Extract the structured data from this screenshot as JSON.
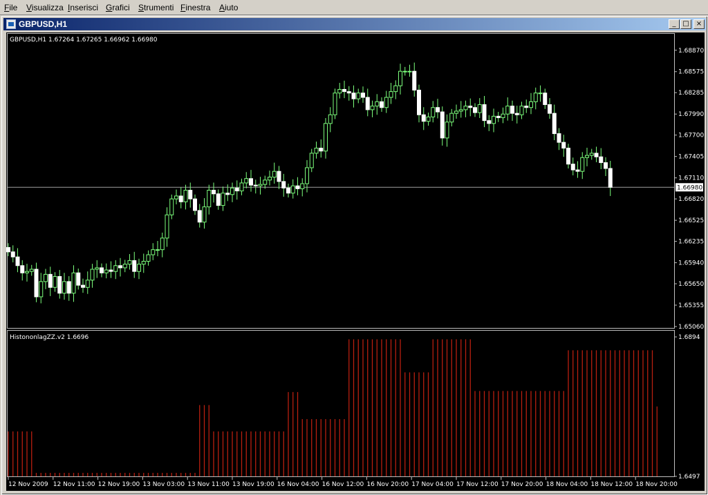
{
  "menu": [
    {
      "accel": "F",
      "rest": "ile"
    },
    {
      "accel": "V",
      "rest": "isualizza"
    },
    {
      "accel": "I",
      "rest": "nserisci"
    },
    {
      "accel": "G",
      "rest": "rafici"
    },
    {
      "accel": "S",
      "rest": "trumenti"
    },
    {
      "accel": "F",
      "rest": "inestra"
    },
    {
      "accel": "A",
      "rest": "iuto"
    }
  ],
  "window": {
    "title": "GBPUSD,H1",
    "minimize": "_",
    "maximize": "□",
    "close": "×"
  },
  "colors": {
    "bull": "#7cff7c",
    "bear": "#ffffff",
    "frame": "#c0c0c0",
    "histogram": "#b82010",
    "bid_line": "#a0a0a0"
  },
  "chart_data": [
    {
      "type": "candlestick",
      "symbol_label": "GBPUSD,H1",
      "ohlc_label": "1.67264 1.67265 1.66962 1.66980",
      "y_ticks": [
        "1.68870",
        "1.68575",
        "1.68285",
        "1.67990",
        "1.67700",
        "1.67405",
        "1.67110",
        "1.66820",
        "1.66525",
        "1.66235",
        "1.65940",
        "1.65650",
        "1.65355",
        "1.65060"
      ],
      "ylim": [
        1.6506,
        1.6902
      ],
      "current_price": "1.66980",
      "x_ticks": [
        "12 Nov 2009",
        "12 Nov 11:00",
        "12 Nov 19:00",
        "13 Nov 03:00",
        "13 Nov 11:00",
        "13 Nov 19:00",
        "16 Nov 04:00",
        "16 Nov 12:00",
        "16 Nov 20:00",
        "17 Nov 04:00",
        "17 Nov 12:00",
        "17 Nov 20:00",
        "18 Nov 04:00",
        "18 Nov 12:00",
        "18 Nov 20:00"
      ],
      "closes": [
        1.6609,
        1.6602,
        1.659,
        1.658,
        1.6582,
        1.6585,
        1.6547,
        1.6568,
        1.6578,
        1.656,
        1.6575,
        1.6552,
        1.6568,
        1.6552,
        1.658,
        1.6563,
        1.656,
        1.657,
        1.6585,
        1.6587,
        1.658,
        1.6584,
        1.6582,
        1.659,
        1.6587,
        1.6592,
        1.6597,
        1.6582,
        1.6592,
        1.6596,
        1.6605,
        1.6612,
        1.6612,
        1.6628,
        1.666,
        1.6682,
        1.6686,
        1.6678,
        1.6694,
        1.6682,
        1.6666,
        1.665,
        1.6671,
        1.6694,
        1.6689,
        1.6673,
        1.669,
        1.6688,
        1.6697,
        1.6693,
        1.6704,
        1.671,
        1.6701,
        1.67,
        1.6702,
        1.6708,
        1.6712,
        1.672,
        1.6706,
        1.6697,
        1.669,
        1.67,
        1.6696,
        1.6703,
        1.6725,
        1.6745,
        1.6752,
        1.6748,
        1.6786,
        1.6798,
        1.6828,
        1.6833,
        1.683,
        1.6828,
        1.682,
        1.6828,
        1.6822,
        1.6805,
        1.681,
        1.6816,
        1.6808,
        1.6822,
        1.683,
        1.6838,
        1.6858,
        1.6858,
        1.6858,
        1.6832,
        1.6798,
        1.6789,
        1.6795,
        1.6808,
        1.6802,
        1.6766,
        1.6788,
        1.68,
        1.6803,
        1.6805,
        1.681,
        1.6808,
        1.6801,
        1.6812,
        1.679,
        1.6786,
        1.6796,
        1.6794,
        1.6799,
        1.681,
        1.68,
        1.6798,
        1.681,
        1.6808,
        1.6816,
        1.6828,
        1.6828,
        1.6812,
        1.68,
        1.6772,
        1.676,
        1.6752,
        1.673,
        1.6722,
        1.672,
        1.6739,
        1.6742,
        1.6745,
        1.674,
        1.6732,
        1.6724,
        1.6698
      ]
    },
    {
      "type": "bar",
      "indicator_label": "HistononlagZZ.v2 1.6696",
      "y_ticks": [
        "1.6894",
        "1.6497"
      ],
      "ylim": [
        1.6497,
        1.6894
      ],
      "x_ticks": [
        "12 Nov 2009",
        "12 Nov 11:00",
        "12 Nov 19:00",
        "13 Nov 03:00",
        "13 Nov 11:00",
        "13 Nov 19:00",
        "16 Nov 04:00",
        "16 Nov 12:00",
        "16 Nov 20:00",
        "17 Nov 04:00",
        "17 Nov 12:00",
        "17 Nov 20:00",
        "18 Nov 04:00",
        "18 Nov 12:00",
        "18 Nov 20:00"
      ],
      "values": [
        1.6625,
        1.6625,
        1.6625,
        1.6625,
        1.6625,
        1.6625,
        1.6507,
        1.6507,
        1.6507,
        1.6507,
        1.6507,
        1.6507,
        1.6507,
        1.6507,
        1.6507,
        1.6507,
        1.6507,
        1.6507,
        1.6507,
        1.6507,
        1.6507,
        1.6507,
        1.6507,
        1.6507,
        1.6507,
        1.6507,
        1.6507,
        1.6507,
        1.6507,
        1.6507,
        1.6507,
        1.6507,
        1.6507,
        1.6507,
        1.6507,
        1.6507,
        1.6507,
        1.6507,
        1.6507,
        1.6507,
        1.6507,
        1.67,
        1.67,
        1.67,
        1.6625,
        1.6625,
        1.6625,
        1.6625,
        1.6625,
        1.6625,
        1.6625,
        1.6625,
        1.6625,
        1.6625,
        1.6625,
        1.6625,
        1.6625,
        1.6625,
        1.6625,
        1.6625,
        1.6737,
        1.6737,
        1.6737,
        1.666,
        1.666,
        1.666,
        1.666,
        1.666,
        1.666,
        1.666,
        1.666,
        1.666,
        1.666,
        1.6887,
        1.6887,
        1.6887,
        1.6887,
        1.6887,
        1.6887,
        1.6887,
        1.6887,
        1.6887,
        1.6887,
        1.6887,
        1.6887,
        1.6793,
        1.6793,
        1.6793,
        1.6793,
        1.6793,
        1.6793,
        1.6887,
        1.6887,
        1.6887,
        1.6887,
        1.6887,
        1.6887,
        1.6887,
        1.6887,
        1.6887,
        1.674,
        1.674,
        1.674,
        1.674,
        1.674,
        1.674,
        1.674,
        1.674,
        1.674,
        1.674,
        1.674,
        1.674,
        1.674,
        1.674,
        1.674,
        1.674,
        1.674,
        1.674,
        1.674,
        1.674,
        1.6856,
        1.6856,
        1.6856,
        1.6856,
        1.6856,
        1.6856,
        1.6856,
        1.6856,
        1.6856,
        1.6856,
        1.6856,
        1.6856,
        1.6856,
        1.6856,
        1.6856,
        1.6856,
        1.6856,
        1.6856,
        1.6856,
        1.6696
      ]
    }
  ]
}
